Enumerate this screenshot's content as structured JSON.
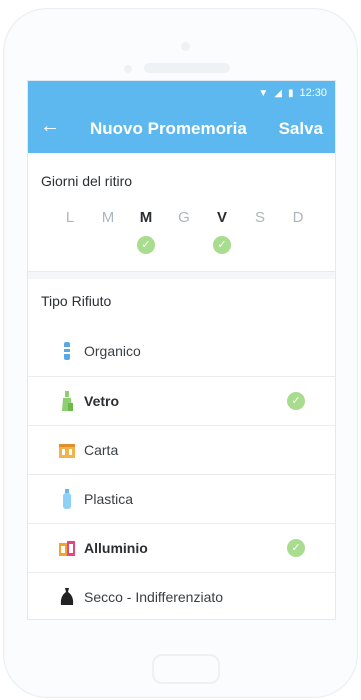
{
  "status_bar": {
    "time": "12:30",
    "wifi_icon": "wifi-icon",
    "signal_icon": "signal-icon",
    "battery_icon": "battery-icon"
  },
  "app_bar": {
    "back_icon": "←",
    "title": "Nuovo Promemoria",
    "save_label": "Salva",
    "color": "#5cb8ee"
  },
  "pickup_days": {
    "title": "Giorni del ritiro",
    "days": [
      {
        "label": "L",
        "selected": false
      },
      {
        "label": "M",
        "selected": false
      },
      {
        "label": "M",
        "selected": true
      },
      {
        "label": "G",
        "selected": false
      },
      {
        "label": "V",
        "selected": true
      },
      {
        "label": "S",
        "selected": false
      },
      {
        "label": "D",
        "selected": false
      }
    ]
  },
  "waste_type": {
    "title": "Tipo Rifiuto",
    "items": [
      {
        "label": "Organico",
        "icon": "organic-icon",
        "selected": false
      },
      {
        "label": "Vetro",
        "icon": "glass-bottle-icon",
        "selected": true
      },
      {
        "label": "Carta",
        "icon": "paper-box-icon",
        "selected": false
      },
      {
        "label": "Plastica",
        "icon": "plastic-bottle-icon",
        "selected": false
      },
      {
        "label": "Alluminio",
        "icon": "aluminium-can-icon",
        "selected": true
      },
      {
        "label": "Secco - Indifferenziato",
        "icon": "trash-bag-icon",
        "selected": false
      }
    ]
  },
  "check_mark": "✓",
  "colors": {
    "check": "#a8dc8e"
  }
}
